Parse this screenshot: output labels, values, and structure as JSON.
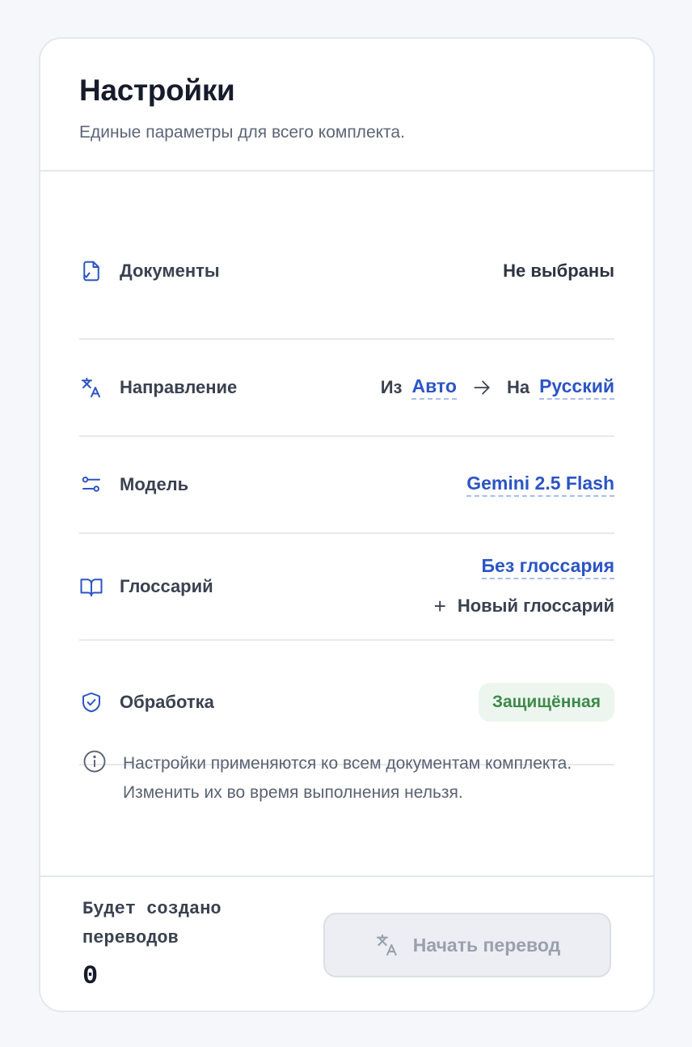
{
  "settings": {
    "title": "Настройки",
    "subtitle": "Единые параметры для всего комплекта."
  },
  "rows": {
    "documents": {
      "icon": "file-check-icon",
      "label": "Документы",
      "value": "Не выбраны"
    },
    "direction": {
      "icon": "translate-icon",
      "label": "Направление",
      "from_prefix": "Из",
      "from_value": "Авто",
      "to_prefix": "На",
      "to_value": "Русский"
    },
    "model": {
      "icon": "sliders-icon",
      "label": "Модель",
      "value": "Gemini 2.5 Flash"
    },
    "glossary": {
      "icon": "book-icon",
      "label": "Глоссарий",
      "value": "Без глоссария",
      "new_glossary_label": "Новый глоссарий"
    },
    "processing": {
      "icon": "shield-check-icon",
      "label": "Обработка",
      "value": "Защищённая"
    }
  },
  "note": {
    "icon": "info-icon",
    "text": "Настройки применяются ко всем документам комплекта. Изменить их во время выполнения нельзя."
  },
  "footer": {
    "count_label": "Будет создано переводов",
    "count_value": "0",
    "start_button_label": "Начать перевод"
  },
  "colors": {
    "accent": "#2c55c5",
    "badge_bg": "#edf6ee",
    "badge_text": "#3d8a4a",
    "disabled_button_bg": "#eceef3"
  }
}
